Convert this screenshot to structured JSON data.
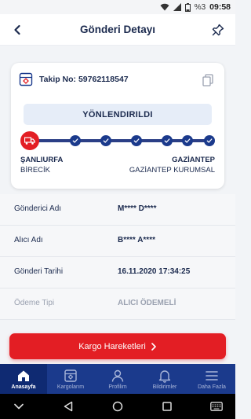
{
  "status_bar": {
    "battery_percent": "%3",
    "time": "09:58"
  },
  "header": {
    "title": "Gönderi Detayı",
    "back_icon": "chevron-left-icon",
    "pin_icon": "pin-icon"
  },
  "tracking_card": {
    "tracking_label": "Takip No: 59762118547",
    "status": "YÖNLENDIRILDI",
    "progress": {
      "total_steps": 7,
      "completed_steps": 7,
      "current_icon": "truck-icon"
    },
    "origin": {
      "city": "ŞANLIURFA",
      "branch": "BİRECİK"
    },
    "destination": {
      "city": "GAZİANTEP",
      "branch": "GAZİANTEP KURUMSAL"
    }
  },
  "details": [
    {
      "label": "Gönderici Adı",
      "value": "M**** D****"
    },
    {
      "label": "Alıcı Adı",
      "value": "B**** A****"
    },
    {
      "label": "Gönderi Tarihi",
      "value": "16.11.2020 17:34:25"
    },
    {
      "label": "Ödeme Tipi",
      "value": "ALICI ÖDEMELİ"
    }
  ],
  "cta": {
    "label": "Kargo Hareketleri",
    "icon": "chevron-right-icon"
  },
  "tabbar": {
    "tabs": [
      {
        "label": "Anasayfa",
        "icon": "home-icon",
        "active": true
      },
      {
        "label": "Kargolarım",
        "icon": "package-icon",
        "active": false
      },
      {
        "label": "Profilim",
        "icon": "user-icon",
        "active": false
      },
      {
        "label": "Bildirimler",
        "icon": "bell-icon",
        "active": false
      },
      {
        "label": "Daha Fazla",
        "icon": "menu-icon",
        "active": false
      }
    ]
  },
  "colors": {
    "brand_red": "#e31e24",
    "brand_navy": "#1b3a8c",
    "text_navy": "#1b2a4e"
  }
}
